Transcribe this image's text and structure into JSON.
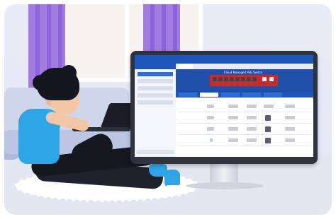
{
  "scene": {
    "description_icons": [
      "person-icon",
      "laptop-icon",
      "monitor-icon"
    ],
    "colors": {
      "curtain": "#8c63d8",
      "shirt": "#2ea6e6",
      "app_blue": "#1c56b8",
      "switch_red": "#c92b2b"
    }
  },
  "app": {
    "title": "",
    "device_label": "Cloud Managed PoE Switch",
    "window_controls": [
      "minimize-icon",
      "maximize-icon",
      "close-icon"
    ]
  }
}
